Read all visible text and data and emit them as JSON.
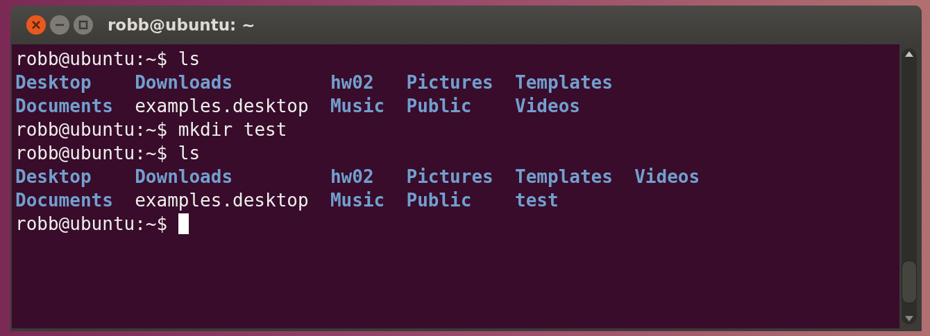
{
  "window": {
    "title": "robb@ubuntu: ~"
  },
  "terminal": {
    "lines": [
      {
        "kind": "command",
        "prompt": "robb@ubuntu:~$",
        "command": "ls"
      },
      {
        "kind": "listing",
        "rows": [
          [
            {
              "name": "Desktop",
              "kind": "dir"
            },
            {
              "name": "Downloads",
              "kind": "dir"
            },
            {
              "name": "hw02",
              "kind": "dir"
            },
            {
              "name": "Pictures",
              "kind": "dir"
            },
            {
              "name": "Templates",
              "kind": "dir"
            }
          ],
          [
            {
              "name": "Documents",
              "kind": "dir"
            },
            {
              "name": "examples.desktop",
              "kind": "file"
            },
            {
              "name": "Music",
              "kind": "dir"
            },
            {
              "name": "Public",
              "kind": "dir"
            },
            {
              "name": "Videos",
              "kind": "dir"
            }
          ]
        ]
      },
      {
        "kind": "command",
        "prompt": "robb@ubuntu:~$",
        "command": "mkdir test"
      },
      {
        "kind": "command",
        "prompt": "robb@ubuntu:~$",
        "command": "ls"
      },
      {
        "kind": "listing",
        "rows": [
          [
            {
              "name": "Desktop",
              "kind": "dir"
            },
            {
              "name": "Downloads",
              "kind": "dir"
            },
            {
              "name": "hw02",
              "kind": "dir"
            },
            {
              "name": "Pictures",
              "kind": "dir"
            },
            {
              "name": "Templates",
              "kind": "dir"
            },
            {
              "name": "Videos",
              "kind": "dir"
            }
          ],
          [
            {
              "name": "Documents",
              "kind": "dir"
            },
            {
              "name": "examples.desktop",
              "kind": "file"
            },
            {
              "name": "Music",
              "kind": "dir"
            },
            {
              "name": "Public",
              "kind": "dir"
            },
            {
              "name": "test",
              "kind": "dir"
            }
          ]
        ]
      },
      {
        "kind": "input",
        "prompt": "robb@ubuntu:~$",
        "cursor": true
      }
    ]
  }
}
